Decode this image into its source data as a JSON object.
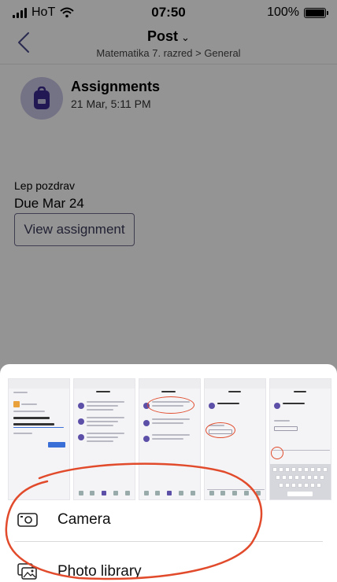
{
  "status_bar": {
    "carrier": "HoT",
    "time": "07:50",
    "battery": "100%",
    "battery_level": 1.0
  },
  "nav": {
    "title": "Post",
    "title_chevron": "⌄",
    "subtitle": "Matematika 7. razred > General",
    "back_icon": "chevron-left-icon"
  },
  "post": {
    "title": "Assignments",
    "timestamp": "21 Mar, 5:11 PM",
    "icon": "backpack-icon",
    "message": "Lep pozdrav",
    "due": "Due Mar 24",
    "button_label": "View assignment"
  },
  "sheet": {
    "camera_label": "Camera",
    "camera_icon": "camera-icon",
    "photos_label": "Photo library",
    "photos_icon": "photo-library-icon"
  },
  "colors": {
    "accent": "#5b4fa8",
    "avatar_bg": "#c9c4e6",
    "annotation": "#e14a2b",
    "overlay": "rgba(0,0,0,0.42)"
  }
}
